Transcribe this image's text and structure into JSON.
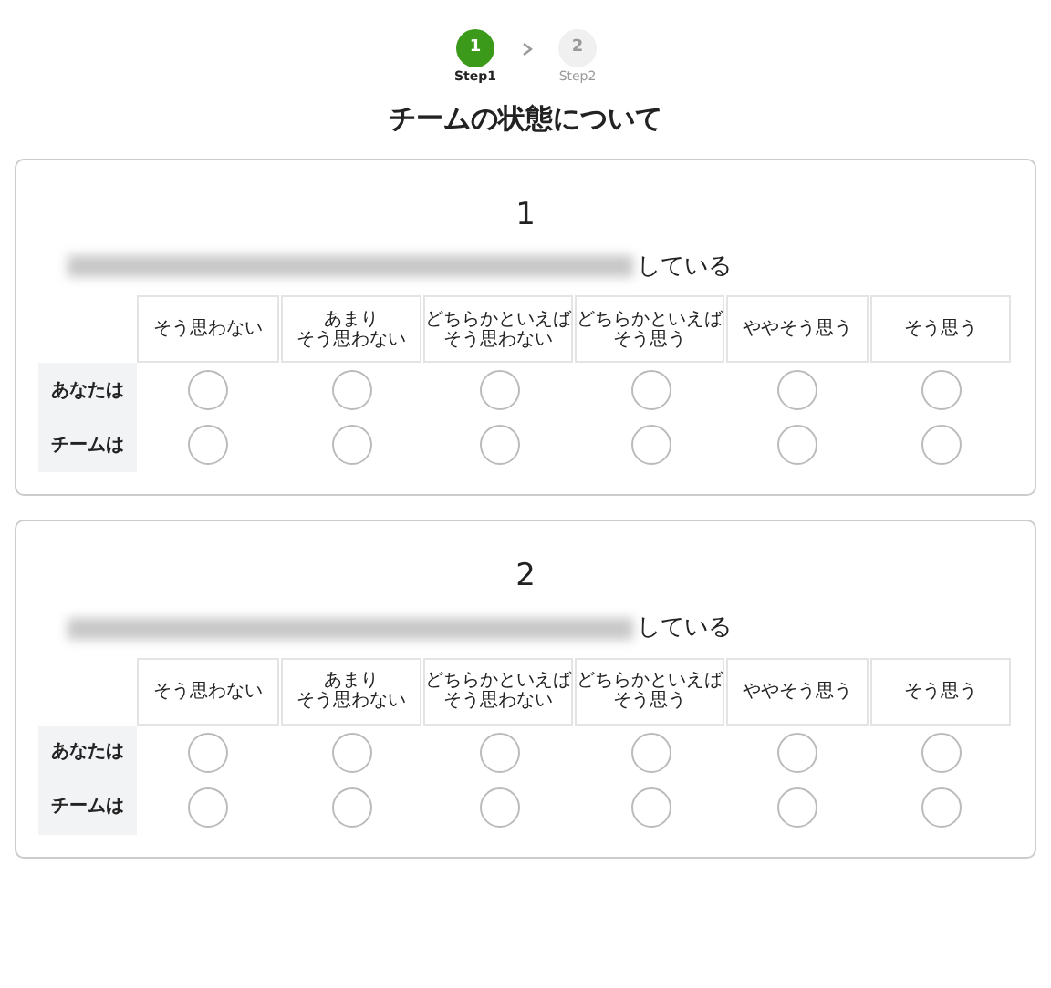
{
  "steps": [
    {
      "number": "1",
      "label": "Step1",
      "selected": true
    },
    {
      "number": "2",
      "label": "Step2",
      "selected": false
    }
  ],
  "title": "チームの状態について",
  "questions": [
    {
      "number": "1",
      "text": "している",
      "redacted": true,
      "columns": [
        [
          "そう思わない"
        ],
        [
          "あまり",
          "そう思わない"
        ],
        [
          "どちらかといえば",
          "そう思わない"
        ],
        [
          "どちらかといえば",
          "そう思う"
        ],
        [
          "ややそう思う"
        ],
        [
          "そう思う"
        ]
      ],
      "rows": [
        {
          "label": "あなたは",
          "options": [
            {
              "selected": false
            },
            {
              "selected": false
            },
            {
              "selected": false
            },
            {
              "selected": false
            },
            {
              "selected": false
            },
            {
              "selected": false
            }
          ]
        },
        {
          "label": "チームは",
          "options": [
            {
              "selected": false
            },
            {
              "selected": false
            },
            {
              "selected": false
            },
            {
              "selected": false
            },
            {
              "selected": false
            },
            {
              "selected": false
            }
          ]
        }
      ]
    },
    {
      "number": "2",
      "text": "している",
      "redacted": true,
      "columns": [
        [
          "そう思わない"
        ],
        [
          "あまり",
          "そう思わない"
        ],
        [
          "どちらかといえば",
          "そう思わない"
        ],
        [
          "どちらかといえば",
          "そう思う"
        ],
        [
          "ややそう思う"
        ],
        [
          "そう思う"
        ]
      ],
      "rows": [
        {
          "label": "あなたは",
          "options": [
            {
              "selected": false
            },
            {
              "selected": false
            },
            {
              "selected": false
            },
            {
              "selected": false
            },
            {
              "selected": false
            },
            {
              "selected": false
            }
          ]
        },
        {
          "label": "チームは",
          "options": [
            {
              "selected": false
            },
            {
              "selected": false
            },
            {
              "selected": false
            },
            {
              "selected": false
            },
            {
              "selected": false
            },
            {
              "selected": false
            }
          ]
        }
      ]
    }
  ]
}
